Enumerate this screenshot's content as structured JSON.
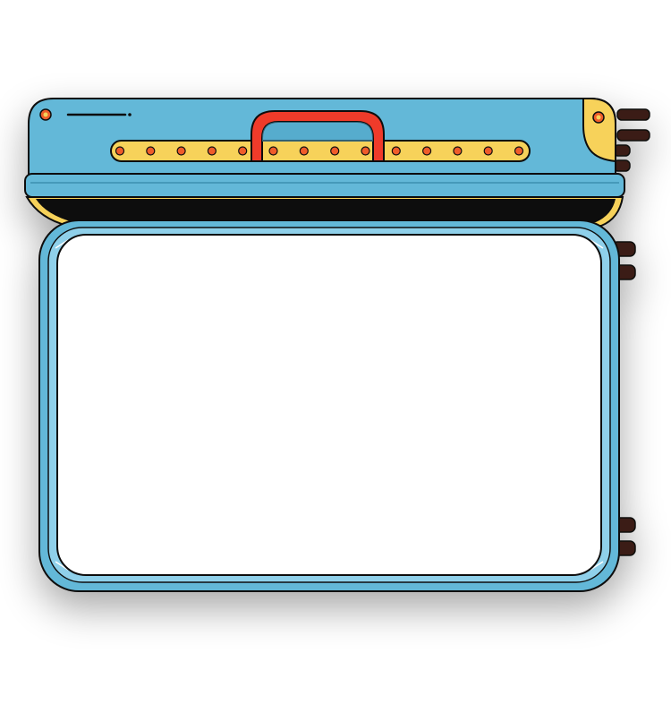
{
  "colors": {
    "shell_blue": "#63B8D8",
    "shell_blue_light": "#8FD0EA",
    "accent_yellow": "#F7D25A",
    "handle_red": "#EF3B2C",
    "rivet_orange": "#EF5B2A",
    "outline": "#111111",
    "hinge_brown": "#3A1F12",
    "screen_white": "#FFFFFF"
  },
  "icons": {
    "lid_corner_left": "rivet-icon",
    "lid_corner_right": "rivet-icon",
    "handle": "handle-icon",
    "hinge": "hinge-icon"
  },
  "rivet_strip": {
    "rivet_count": 14
  },
  "screen": {
    "text": ""
  }
}
